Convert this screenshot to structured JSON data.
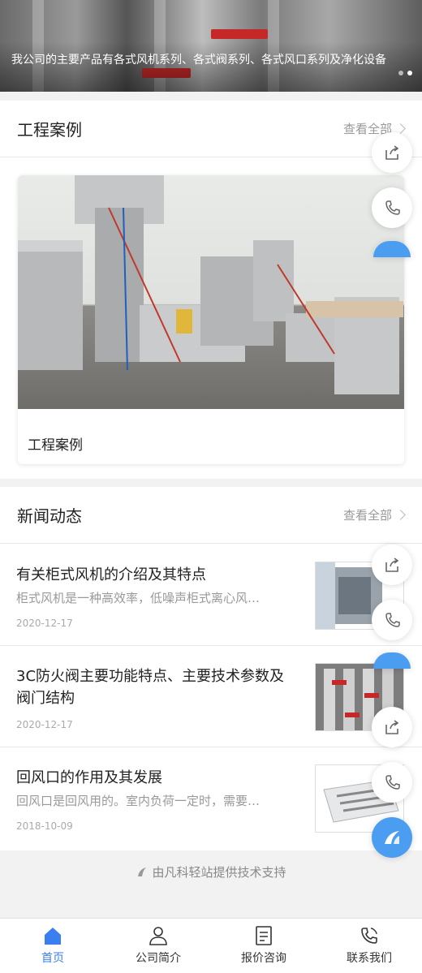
{
  "banner": {
    "caption": "我公司的主要产品有各式风机系列、各式阀系列、各式风口系列及净化设备"
  },
  "cases": {
    "title": "工程案例",
    "more": "查看全部",
    "card_title": "工程案例"
  },
  "news": {
    "title": "新闻动态",
    "more": "查看全部",
    "items": [
      {
        "title": "有关柜式风机的介绍及其特点",
        "desc": "柜式风机是一种高效率，低噪声柜式离心风…",
        "date": "2020-12-17"
      },
      {
        "title": "3C防火阀主要功能特点、主要技术参数及阀门结构",
        "desc": "",
        "date": "2020-12-17"
      },
      {
        "title": "回风口的作用及其发展",
        "desc": "回风口是回风用的。室内负荷一定时，需要…",
        "date": "2018-10-09"
      }
    ]
  },
  "support": "由凡科轻站提供技术支持",
  "tabs": [
    {
      "label": "首页",
      "icon": "home-icon",
      "active": true
    },
    {
      "label": "公司简介",
      "icon": "person-icon",
      "active": false
    },
    {
      "label": "报价咨询",
      "icon": "document-icon",
      "active": false
    },
    {
      "label": "联系我们",
      "icon": "phone-icon",
      "active": false
    }
  ],
  "colors": {
    "accent": "#3a7ff0",
    "float_blue": "#4a9df0"
  }
}
